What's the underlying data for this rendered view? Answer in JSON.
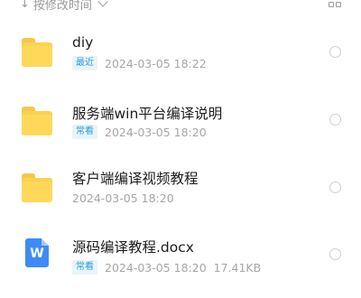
{
  "toolbar": {
    "sort_label": "按修改时间",
    "sort_arrow_icon": "down-arrow-icon",
    "view_icon": "grid-view-icon"
  },
  "files": [
    {
      "type": "folder",
      "icon": "folder-icon",
      "name": "diy",
      "badge": "最近",
      "datetime": "2024-03-05  18:22",
      "size": ""
    },
    {
      "type": "folder",
      "icon": "folder-icon",
      "name": "服务端win平台编译说明",
      "badge": "常看",
      "datetime": "2024-03-05  18:20",
      "size": ""
    },
    {
      "type": "folder",
      "icon": "folder-icon",
      "name": "客户端编译视频教程",
      "badge": "",
      "datetime": "2024-03-05  18:20",
      "size": ""
    },
    {
      "type": "docx",
      "icon": "word-doc-icon",
      "name": "源码编译教程.docx",
      "badge": "常看",
      "datetime": "2024-03-05  18:20",
      "size": "17.41KB"
    }
  ],
  "colors": {
    "folder": "#fbd24c",
    "doc": "#3e8af7",
    "badge_bg": "#e8f4fb",
    "badge_fg": "#2a9ad8"
  }
}
